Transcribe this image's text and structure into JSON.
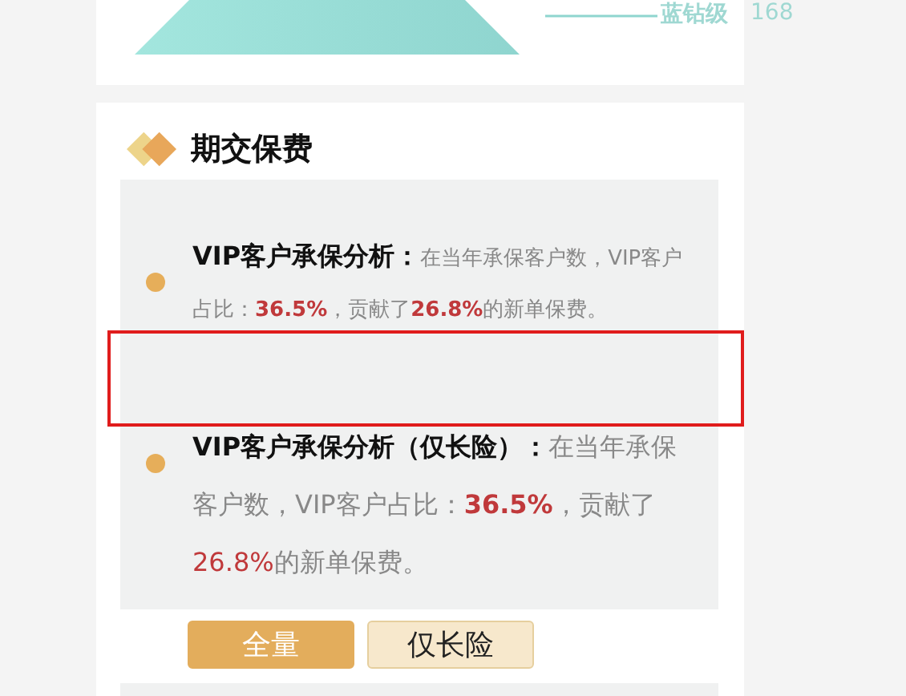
{
  "pyramid": {
    "label": "蓝钻级",
    "value": "168"
  },
  "section": {
    "title": "期交保费",
    "items": [
      {
        "kind": "compact",
        "title": "VIP客户承保分析：",
        "parts": [
          {
            "text": "在当年承保客户数，VIP客户占比：",
            "kind": "plain"
          },
          {
            "text": "36.5%",
            "kind": "figure"
          },
          {
            "text": "，贡献了",
            "kind": "plain"
          },
          {
            "text": "26.8%",
            "kind": "figure"
          },
          {
            "text": "的新单保费。",
            "kind": "plain"
          }
        ]
      },
      {
        "kind": "large",
        "title": "VIP客户承保分析（仅长险）：",
        "parts": [
          {
            "text": "在当年承保客户数，VIP客户占比：",
            "kind": "plain"
          },
          {
            "text": "36.5%",
            "kind": "figure"
          },
          {
            "text": "，贡献了",
            "kind": "plain"
          },
          {
            "text": "26.8%",
            "kind": "figure_light"
          },
          {
            "text": "的新单保费。",
            "kind": "plain"
          }
        ]
      }
    ],
    "tabs": [
      {
        "label": "全量",
        "selected": true
      },
      {
        "label": "仅长险",
        "selected": false
      }
    ]
  },
  "highlight_box": true
}
